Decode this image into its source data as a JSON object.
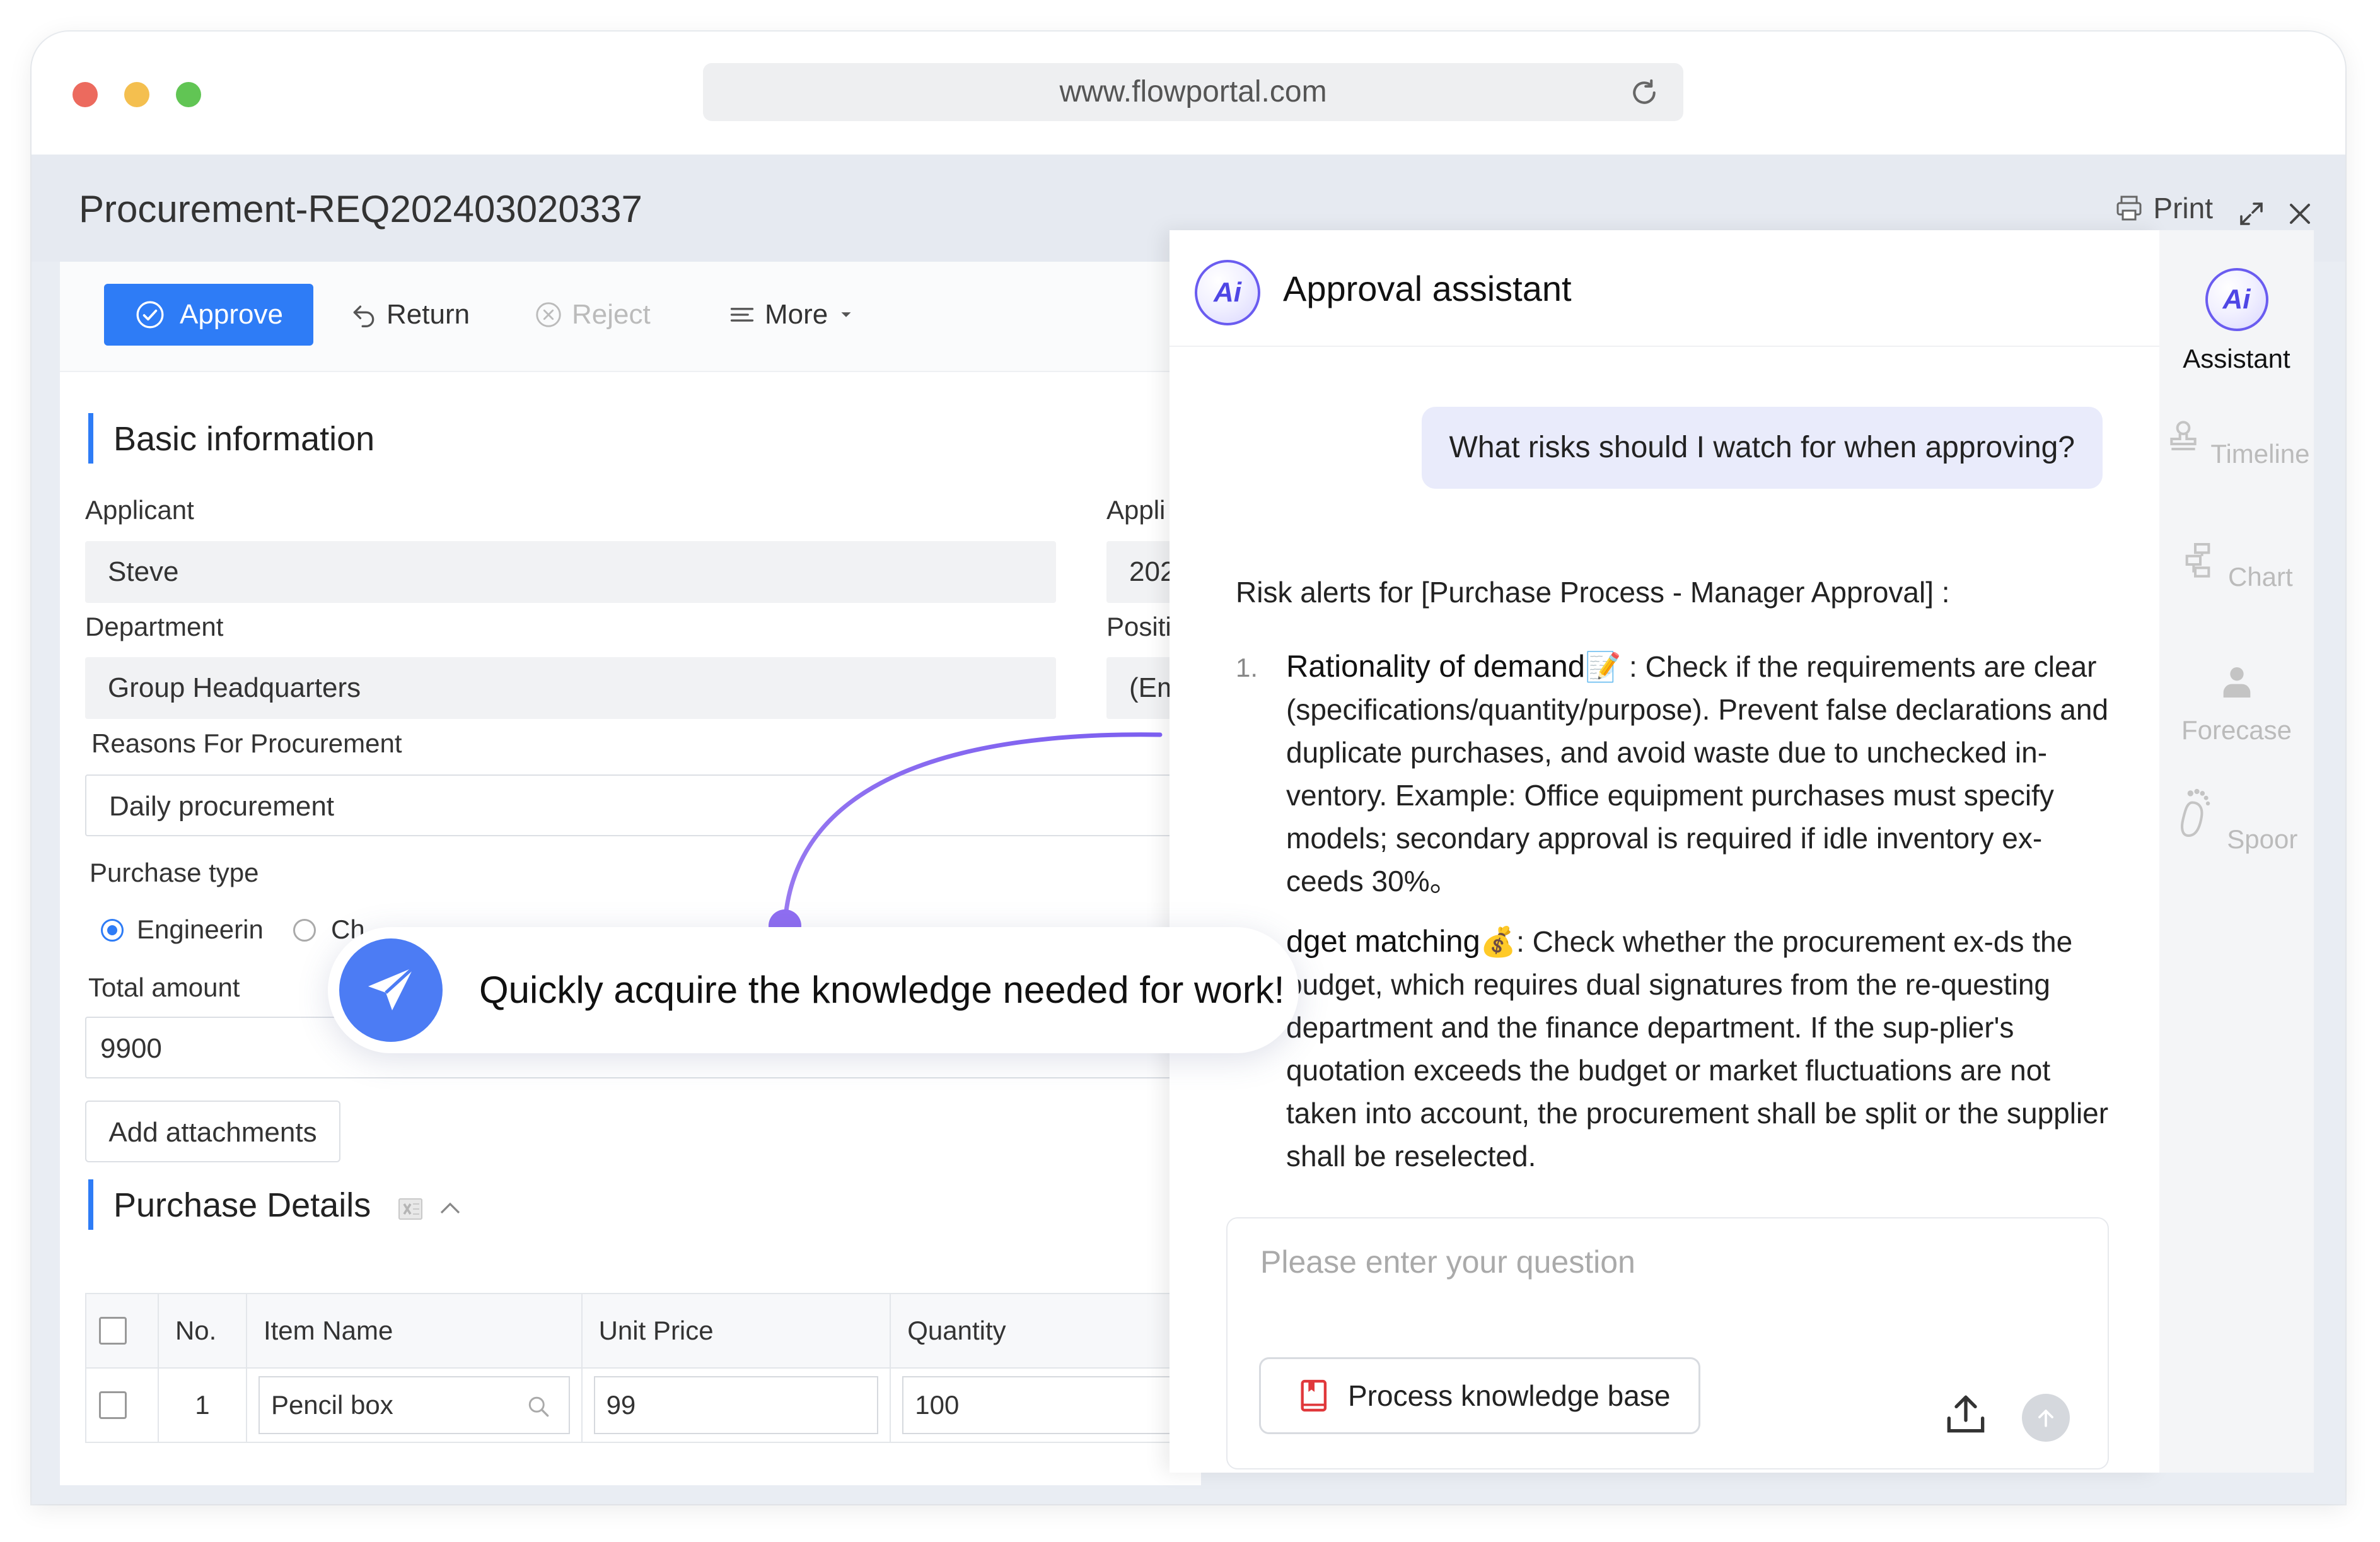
{
  "browser": {
    "url": "www.flowportal.com",
    "dots": [
      "#ec6a5e",
      "#f4bf4f",
      "#61c554"
    ]
  },
  "header": {
    "title": "Procurement-REQ202403020337",
    "print_label": "Print"
  },
  "toolbar": {
    "approve": "Approve",
    "return": "Return",
    "reject": "Reject",
    "more": "More"
  },
  "basic_info": {
    "section_title": "Basic information",
    "applicant_label": "Applicant",
    "applicant_value": "Steve",
    "applied_label_partial": "Appli",
    "applied_value_partial": "202",
    "department_label": "Department",
    "department_value": "Group Headquarters",
    "position_label_partial": "Positi",
    "position_value_partial": "(Em",
    "reasons_label": "Reasons For Procurement",
    "reasons_value": "Daily procurement",
    "purchase_type_label": "Purchase type",
    "purchase_type_options": [
      "Engineerin",
      "Ch"
    ],
    "total_label": "Total amount",
    "total_value": "9900",
    "add_attachments": "Add attachments"
  },
  "purchase_details": {
    "section_title": "Purchase Details",
    "columns": [
      "No.",
      "Item Name",
      "Unit Price",
      "Quantity"
    ],
    "rows": [
      {
        "no": "1",
        "item": "Pencil box",
        "price": "99",
        "qty": "100"
      }
    ]
  },
  "callout": {
    "text": "Quickly acquire the knowledge needed for work!"
  },
  "assistant": {
    "logo_text": "Ai",
    "title": "Approval assistant",
    "question": "What risks should I watch for when approving?",
    "intro": "Risk alerts for [Purchase Process - Manager Approval] :",
    "items": [
      {
        "num": "1.",
        "title": "Rationality of demand",
        "emoji": "📝",
        "text": " : Check if the requirements are clear (specifications/quantity/purpose). Prevent false declarations and duplicate purchases, and avoid waste due to unchecked in-ventory. Example: Office equipment purchases must specify models; secondary approval is required if idle inventory ex-ceeds 30%。"
      },
      {
        "num": "",
        "title": "dget matching",
        "emoji": "💰",
        "text": ":  Check whether the procurement ex-ds the budget, which requires dual signatures from the re-questing department and the finance department. If the sup-plier's quotation exceeds the budget or market fluctuations are not taken into account, the procurement shall be split or the supplier shall be reselected."
      }
    ],
    "input_placeholder": "Please enter your question",
    "kb_button": "Process knowledge base"
  },
  "rail": {
    "items": [
      {
        "label": "Assistant",
        "icon": "ai-icon",
        "active": true
      },
      {
        "label": "Timeline",
        "icon": "stamp-icon",
        "active": false
      },
      {
        "label": "Chart",
        "icon": "flowchart-icon",
        "active": false
      },
      {
        "label": "Forecase",
        "icon": "user-icon",
        "active": false
      },
      {
        "label": "Spoor",
        "icon": "footprint-icon",
        "active": false
      }
    ]
  },
  "colors": {
    "primary": "#2e7cf6",
    "ai_purple": "#6a5cf0",
    "callout_blue": "#4c7cf4",
    "question_bg": "#e9ebfb"
  }
}
